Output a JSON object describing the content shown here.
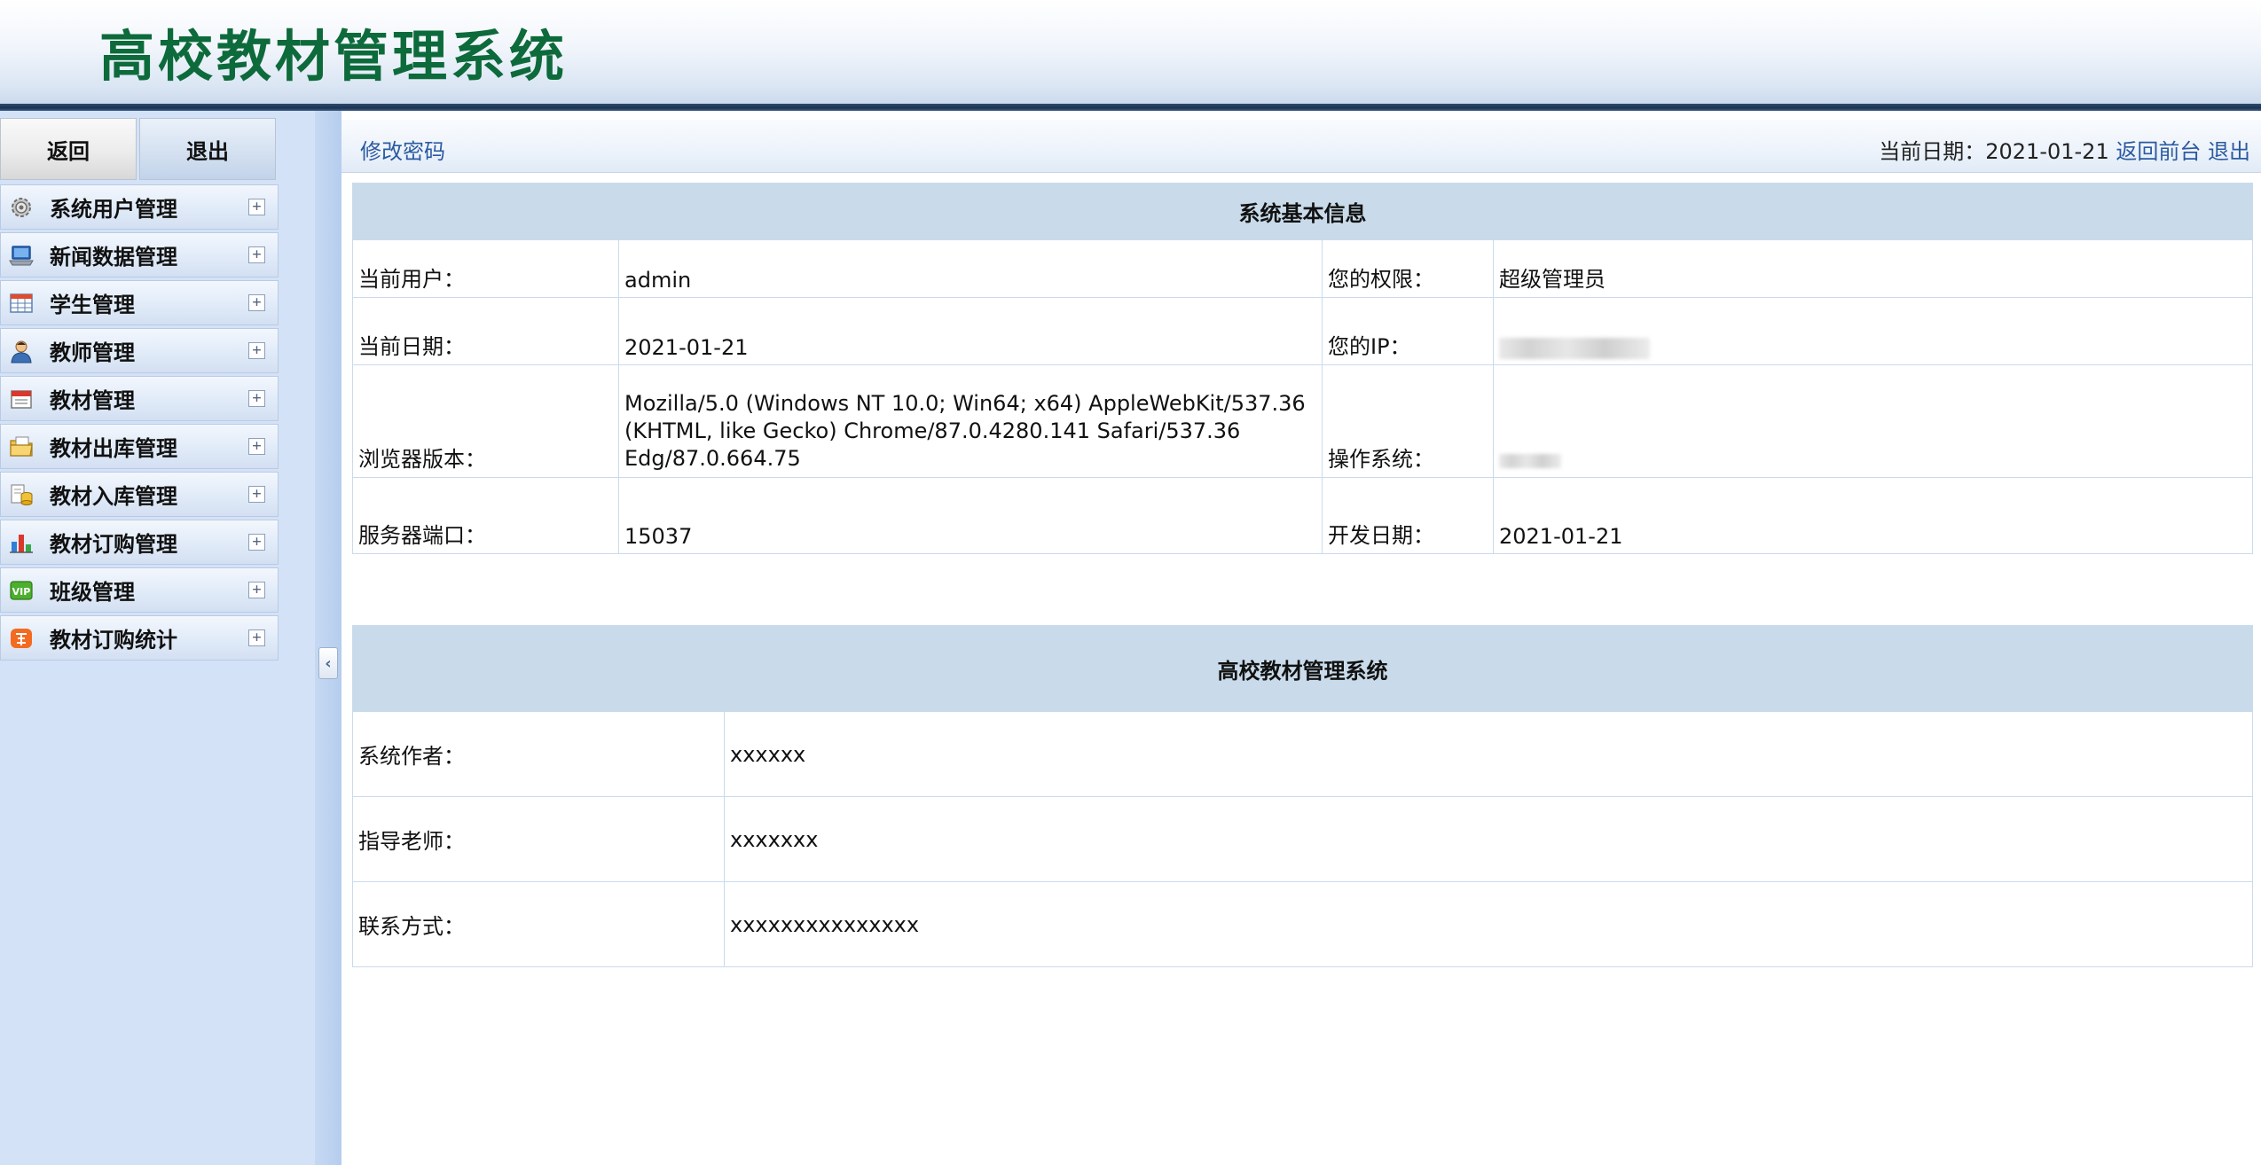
{
  "header": {
    "title": "高校教材管理系统"
  },
  "sidebar": {
    "top_buttons": {
      "back": "返回",
      "exit": "退出"
    },
    "items": [
      {
        "label": "系统用户管理",
        "icon": "gear-icon"
      },
      {
        "label": "新闻数据管理",
        "icon": "laptop-icon"
      },
      {
        "label": "学生管理",
        "icon": "table-icon"
      },
      {
        "label": "教师管理",
        "icon": "person-icon"
      },
      {
        "label": "教材管理",
        "icon": "calendar-icon"
      },
      {
        "label": "教材出库管理",
        "icon": "folder-icon"
      },
      {
        "label": "教材入库管理",
        "icon": "database-icon"
      },
      {
        "label": "教材订购管理",
        "icon": "bar-chart-icon"
      },
      {
        "label": "班级管理",
        "icon": "vip-icon"
      },
      {
        "label": "教材订购统计",
        "icon": "taobao-icon"
      }
    ],
    "expand_symbol": "+",
    "collapse_symbol": "‹"
  },
  "topbar": {
    "change_password": "修改密码",
    "date_label": "当前日期：",
    "date_value": "2021-01-21",
    "home_link": "返回前台",
    "logout_link": "退出"
  },
  "system_info": {
    "title": "系统基本信息",
    "current_user_label": "当前用户：",
    "current_user_value": "admin",
    "permission_label": "您的权限：",
    "permission_value": "超级管理员",
    "current_date_label": "当前日期：",
    "current_date_value": "2021-01-21",
    "ip_label": "您的IP：",
    "browser_label": "浏览器版本：",
    "browser_value": "Mozilla/5.0 (Windows NT 10.0; Win64; x64) AppleWebKit/537.36 (KHTML, like Gecko) Chrome/87.0.4280.141 Safari/537.36 Edg/87.0.664.75",
    "os_label": "操作系统：",
    "port_label": "服务器端口：",
    "port_value": "15037",
    "dev_date_label": "开发日期：",
    "dev_date_value": "2021-01-21"
  },
  "system_author": {
    "title": "高校教材管理系统",
    "author_label": "系统作者：",
    "author_value": "xxxxxx",
    "advisor_label": "指导老师：",
    "advisor_value": "xxxxxxx",
    "contact_label": "联系方式：",
    "contact_value": "xxxxxxxxxxxxxxx"
  }
}
